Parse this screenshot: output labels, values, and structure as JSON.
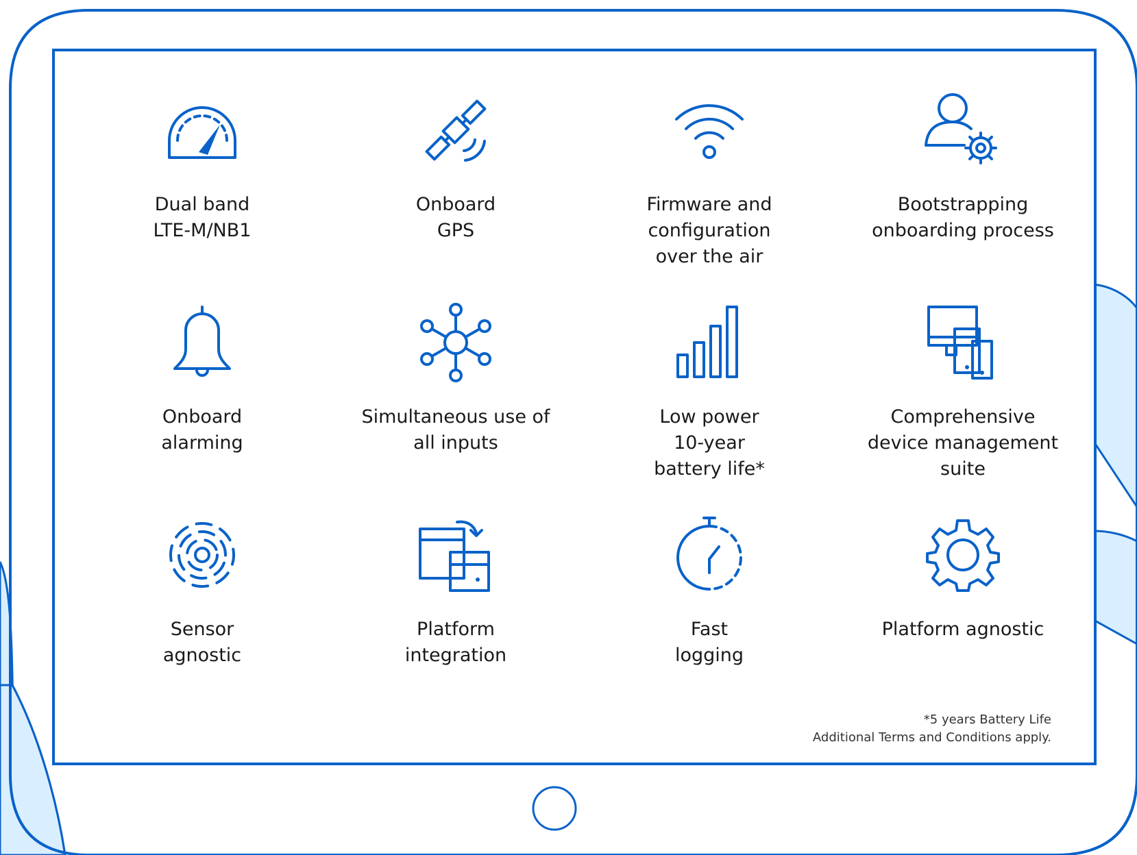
{
  "colors": {
    "accent": "#0a62c9",
    "hand": "#d9efff",
    "text": "#1a1a1a"
  },
  "features": [
    {
      "icon": "speedometer-icon",
      "label": "Dual band\nLTE-M/NB1"
    },
    {
      "icon": "satellite-icon",
      "label": "Onboard\nGPS"
    },
    {
      "icon": "wifi-icon",
      "label": "Firmware and\nconfiguration\nover the air"
    },
    {
      "icon": "user-gear-icon",
      "label": "Bootstrapping\nonboarding process"
    },
    {
      "icon": "bell-icon",
      "label": "Onboard\nalarming"
    },
    {
      "icon": "hub-network-icon",
      "label": "Simultaneous use of\nall inputs"
    },
    {
      "icon": "signal-bars-icon",
      "label": "Low power\n10-year\nbattery life*"
    },
    {
      "icon": "devices-icon",
      "label": "Comprehensive\ndevice management\nsuite"
    },
    {
      "icon": "sensor-radar-icon",
      "label": "Sensor\nagnostic"
    },
    {
      "icon": "platform-integration-icon",
      "label": "Platform\nintegration"
    },
    {
      "icon": "stopwatch-icon",
      "label": "Fast\nlogging"
    },
    {
      "icon": "gear-icon",
      "label": "Platform agnostic"
    }
  ],
  "footnote": {
    "line1": "*5 years Battery Life",
    "line2": "Additional Terms and Conditions apply."
  }
}
